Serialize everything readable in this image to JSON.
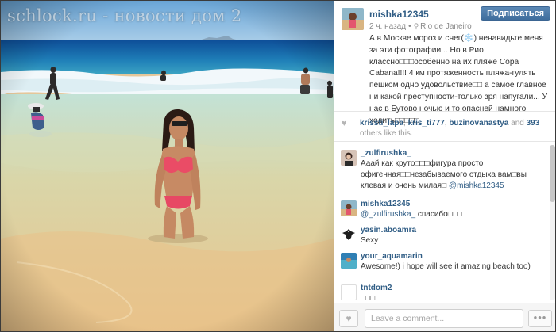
{
  "watermark": "schlock.ru - новости дом 2",
  "post": {
    "username": "mishka12345",
    "follow_label": "Подписаться",
    "time": "2 ч. назад",
    "location": "Rio de Janeiro",
    "location_icon": "pin-icon",
    "caption": "А в Москве мороз и снег(❄️) ненавидьте меня за эти фотографии... Но в Рио классно□□□особенно на их пляже Copa Cabana!!!! 4 км протяженность пляжа-гулять пешком одно удовольствие□□ а самое главное ни какой преступности-только зря напугали... У нас в Бутово ночью и то опасней намного ходить□□□□□"
  },
  "likes": {
    "users": [
      "krissti_lapa",
      "kris_ti777",
      "buzinovanastya"
    ],
    "and_text": "and",
    "count": "393",
    "others_text": "others like this."
  },
  "comments": [
    {
      "user": "_zulfirushka_",
      "text": "Ааай как круто□□□фигура просто офигенная□□незабываемого отдыха вам□вы клевая и очень милая□",
      "mention": "@mishka12345"
    },
    {
      "user": "mishka12345",
      "mention": "@_zulfirushka_",
      "text": " спасибо□□□"
    },
    {
      "user": "yasin.aboamra",
      "text": "Sexy"
    },
    {
      "user": "your_aquamarin",
      "text": "Awesome!) i hope will see it amazing beach too)"
    },
    {
      "user": "tntdom2",
      "text": "□□□"
    }
  ],
  "footer": {
    "comment_placeholder": "Leave a comment...",
    "more_label": "•••"
  },
  "colors": {
    "link": "#305d85",
    "follow_button": "#4a78a6"
  }
}
